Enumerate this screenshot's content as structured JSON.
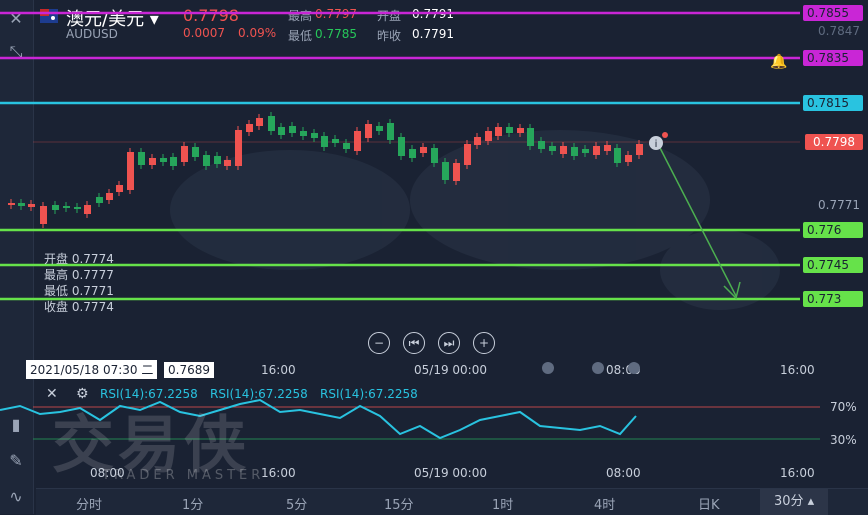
{
  "header": {
    "pair": "澳元/美元",
    "symbol": "AUDUSD",
    "price": "0.7798",
    "change": "0.0007",
    "change_pct": "0.09%",
    "high_label": "最高",
    "high": "0.7797",
    "open_label": "开盘",
    "open": "0.7791",
    "low_label": "最低",
    "low": "0.7785",
    "prev_close_label": "昨收",
    "prev_close": "0.7791"
  },
  "price_axis": {
    "top_labels": [
      "0.7847",
      "0.78"
    ],
    "mid": "0.7771"
  },
  "lines": [
    {
      "value": "0.7855",
      "color": "#c926d6"
    },
    {
      "value": "0.7835",
      "color": "#c926d6"
    },
    {
      "value": "0.7815",
      "color": "#29c3e0"
    },
    {
      "value": "0.776",
      "color": "#66e24a"
    },
    {
      "value": "0.7745",
      "color": "#66e24a"
    },
    {
      "value": "0.773",
      "color": "#66e24a"
    }
  ],
  "current_price_tag": "0.7798",
  "ohlc": {
    "open_label": "开盘",
    "open": "0.7774",
    "high_label": "最高",
    "high": "0.7777",
    "low_label": "最低",
    "low": "0.7771",
    "close_label": "收盘",
    "close": "0.7774"
  },
  "crosshair": {
    "date": "2021/05/18 07:30 二",
    "value": "0.7689"
  },
  "time_axis": [
    "16:00",
    "05/19 00:00",
    "08:00",
    "16:00"
  ],
  "time_axis_low": [
    "08:00",
    "16:00",
    "05/19 00:00",
    "08:00",
    "16:00"
  ],
  "rsi": {
    "labels": [
      "RSI(14):67.2258",
      "RSI(14):67.2258",
      "RSI(14):67.2258"
    ],
    "upper": "70%",
    "lower": "30%"
  },
  "watermark": {
    "cn": "交易侠",
    "en": "TRADER MASTER"
  },
  "tabs": [
    "分时",
    "1分",
    "5分",
    "15分",
    "1时",
    "4时",
    "日K",
    "30分"
  ],
  "active_tab": "30分",
  "colors": {
    "up": "#ef5350",
    "down": "#26a65b",
    "bg": "#1a2233",
    "rsi": "#29c3e0",
    "arrow": "#4caf50"
  }
}
